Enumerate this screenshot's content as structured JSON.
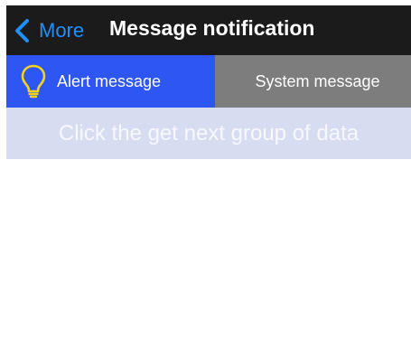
{
  "navbar": {
    "back_label": "More",
    "title": "Message notification"
  },
  "tabs": [
    {
      "label": "Alert message",
      "icon": "lightbulb-icon",
      "selected": true
    },
    {
      "label": "System message",
      "selected": false
    }
  ],
  "load_more": {
    "label": "Click the get next group of data"
  },
  "colors": {
    "navbar_bg": "#1b1b1b",
    "accent_blue": "#1e90ff",
    "tab_active_bg": "#2d56f2",
    "tab_inactive_bg": "#7d7d7d",
    "load_more_bg": "#d8dcf1",
    "bulb_color": "#f5d21b"
  }
}
